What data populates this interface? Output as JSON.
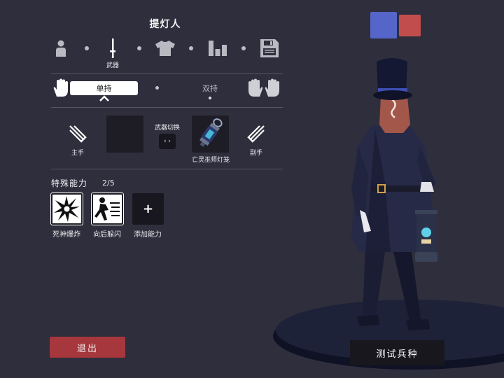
{
  "unit": {
    "name": "提灯人"
  },
  "steps": [
    {
      "icon": "person-icon"
    },
    {
      "icon": "sword-icon",
      "label": "武器",
      "active": true
    },
    {
      "icon": "shirt-icon"
    },
    {
      "icon": "stats-icon"
    },
    {
      "icon": "save-icon"
    }
  ],
  "grip": {
    "single": "单持",
    "dual": "双持",
    "selected": "单持"
  },
  "weapons": {
    "main_hand": "主手",
    "off_hand": "副手",
    "switch_label": "武器切换",
    "switch_arrows": "‹ ›",
    "equipped_name": "亡灵巫师灯笼"
  },
  "abilities": {
    "title": "特殊能力",
    "count": "2/5",
    "items": [
      {
        "label": "死神爆炸",
        "icon": "explosion-icon"
      },
      {
        "label": "向后躲闪",
        "icon": "dodge-back-icon"
      },
      {
        "label": "添加能力",
        "icon": "plus-icon",
        "glyph": "+"
      }
    ]
  },
  "buttons": {
    "exit": "退出",
    "test": "测试兵种"
  },
  "colors": {
    "team_blue": "#5565c9",
    "team_red": "#c14e4d",
    "exit_button": "#a6373c",
    "background": "#2f2e3c"
  }
}
